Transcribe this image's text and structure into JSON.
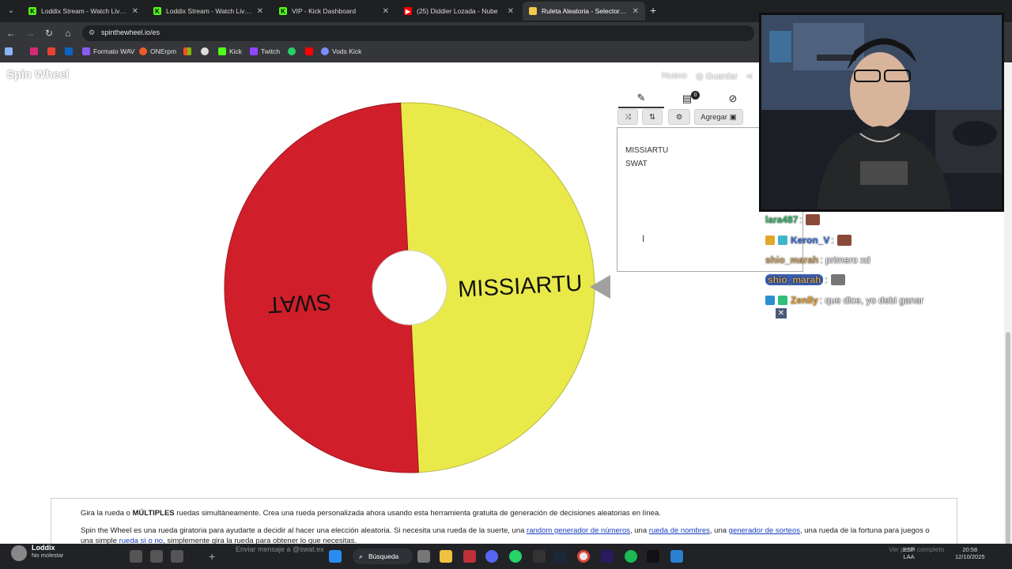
{
  "browser": {
    "tabs": [
      {
        "title": "Loddix Stream - Watch Live on",
        "favicon": "kick-icon",
        "color": "#53fc18"
      },
      {
        "title": "Loddix Stream - Watch Live on",
        "favicon": "kick-icon",
        "color": "#53fc18"
      },
      {
        "title": "VIP - Kick Dashboard",
        "favicon": "kick-icon",
        "color": "#53fc18"
      },
      {
        "title": "(25) Diddier Lozada - Nube",
        "favicon": "youtube-icon",
        "color": "#ff0000"
      },
      {
        "title": "Ruleta Aleatoria - Selector Pers",
        "favicon": "spinwheel-icon",
        "color": "#f2c94c",
        "active": true
      }
    ],
    "url": "spinthewheel.io/es",
    "bookmarks": [
      "Formato WAV",
      "ONErpm",
      "Kick",
      "Twitch",
      "Vods Kick"
    ]
  },
  "site": {
    "brand": "Spin Wheel",
    "nav": {
      "new_label": "Nuevo",
      "save_label": "Guardar"
    }
  },
  "wheel": {
    "segments": [
      {
        "label": "MISSIARTU",
        "color": "#e9ea4a"
      },
      {
        "label": "SWAT",
        "color": "#d01f2a"
      }
    ]
  },
  "editor": {
    "badge_count": "0",
    "add_label": "Agregar",
    "entries": [
      "MISSIARTU",
      "SWAT"
    ]
  },
  "chat": [
    {
      "user": "lara487",
      "user_color": "#39b26a",
      "msg": ""
    },
    {
      "user": "Keron_V",
      "user_color": "#3a6fd8",
      "msg": ""
    },
    {
      "user": "shio_marah",
      "user_color": "#c9a063",
      "msg": "primero xd"
    },
    {
      "user": "shio_marah",
      "user_color": "#c9a063",
      "msg": ""
    },
    {
      "user": "Zenlly",
      "user_color": "#e09a2a",
      "msg": "que dice, yo debi ganar"
    }
  ],
  "description": {
    "line1_prefix": "Gira la rueda o ",
    "line1_bold": "MÚLTIPLES",
    "line1_suffix": " ruedas simultáneamente. Crea una rueda personalizada ahora usando esta herramienta gratuita de generación de decisiones aleatorias en línea.",
    "line2_a": "Spin the Wheel es una rueda giratoria para ayudarte a decidir al hacer una elección aleatoria. Si necesita una rueda de la suerte, una ",
    "link1": "random generador de números",
    "line2_b": ", una ",
    "link2": "rueda de nombres",
    "line2_c": ", una ",
    "link3": "generador de sorteos",
    "line2_d": ", una rueda de la fortuna para juegos o una simple ",
    "link4": "rueda sí o no",
    "line2_e": ", simplemente gira la rueda para obtener lo que necesitas."
  },
  "taskbar": {
    "user_name": "Loddix",
    "user_status": "No molestar",
    "message_placeholder": "Enviar mensaje a @swat.ex",
    "search_label": "Búsqueda",
    "lang": "ESP",
    "region": "LAA",
    "time": "20:58",
    "date": "12/10/2025",
    "watermark": "Ver perfil completo"
  }
}
